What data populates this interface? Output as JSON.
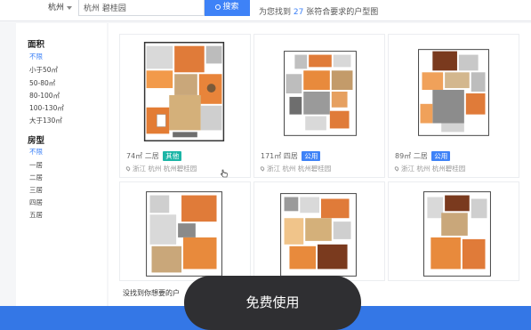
{
  "header": {
    "city": "杭州",
    "search_value": "杭州 碧桂园",
    "search_button": "搜索",
    "result_prefix": "为您找到",
    "result_count": "27",
    "result_suffix": "张符合要求的户型图"
  },
  "filters": {
    "area_title": "面积",
    "area_options": [
      "不限",
      "小于50㎡",
      "50-80㎡",
      "80-100㎡",
      "100-130㎡",
      "大于130㎡"
    ],
    "room_title": "房型",
    "room_options": [
      "不限",
      "一居",
      "二居",
      "三居",
      "四居",
      "五居"
    ]
  },
  "cards": [
    {
      "area": "74㎡",
      "rooms": "二居",
      "tag": "其他",
      "location": "浙江 杭州",
      "community": "杭州碧桂园"
    },
    {
      "area": "171㎡",
      "rooms": "四居",
      "tag": "公用",
      "location": "浙江 杭州",
      "community": "杭州碧桂园"
    },
    {
      "area": "89㎡",
      "rooms": "二居",
      "tag": "公用",
      "location": "浙江 杭州",
      "community": "杭州碧桂园"
    }
  ],
  "footer_hint": "没找到你想要的户",
  "cta_label": "免费使用",
  "colors": {
    "accent": "#3e82f7",
    "tag_teal": "#1bb5a6",
    "cta_bg": "#2f2f32",
    "strip": "#3477e6"
  }
}
